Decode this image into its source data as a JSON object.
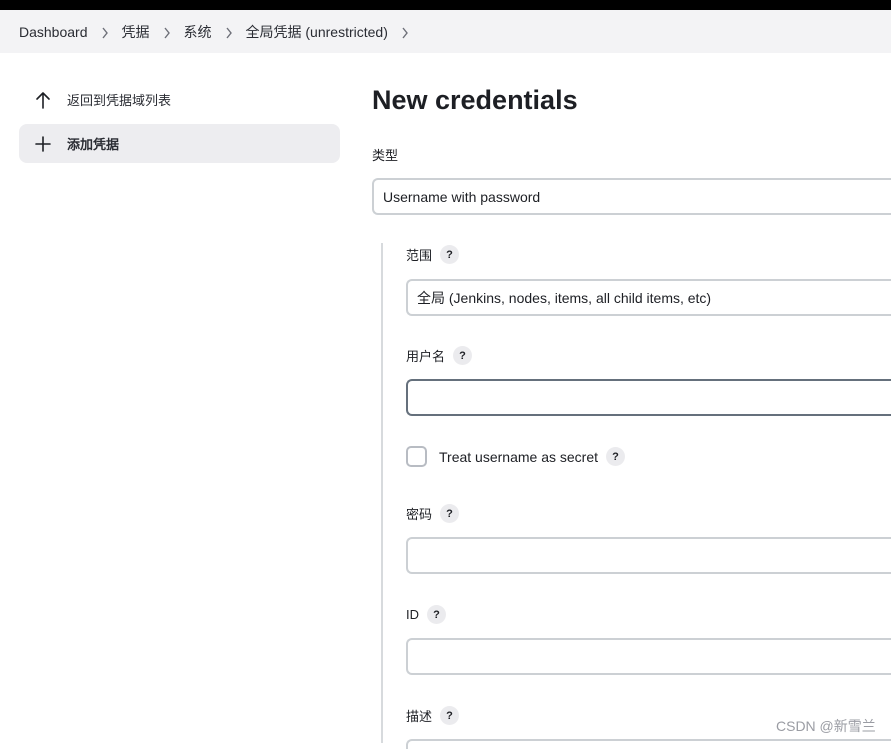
{
  "breadcrumb": {
    "items": [
      "Dashboard",
      "凭据",
      "系统",
      "全局凭据 (unrestricted)"
    ]
  },
  "sidebar": {
    "items": [
      {
        "label": "返回到凭据域列表",
        "icon": "arrow-up-icon"
      },
      {
        "label": "添加凭据",
        "icon": "plus-icon",
        "active": true
      }
    ]
  },
  "main": {
    "title": "New credentials",
    "type_label": "类型",
    "type_value": "Username with password",
    "scope_label": "范围",
    "scope_value": "全局 (Jenkins, nodes, items, all child items, etc)",
    "username_label": "用户名",
    "username_value": "",
    "treat_secret_label": "Treat username as secret",
    "password_label": "密码",
    "password_value": "",
    "id_label": "ID",
    "id_value": "",
    "description_label": "描述",
    "help_symbol": "?"
  },
  "watermark": "CSDN @新雪兰",
  "colors": {
    "topbar": "#000000",
    "breadcrumb_bg": "#f3f3f5",
    "active_item_bg": "#ededf0",
    "input_border": "#ccd0d4",
    "focused_border": "#65707c"
  }
}
